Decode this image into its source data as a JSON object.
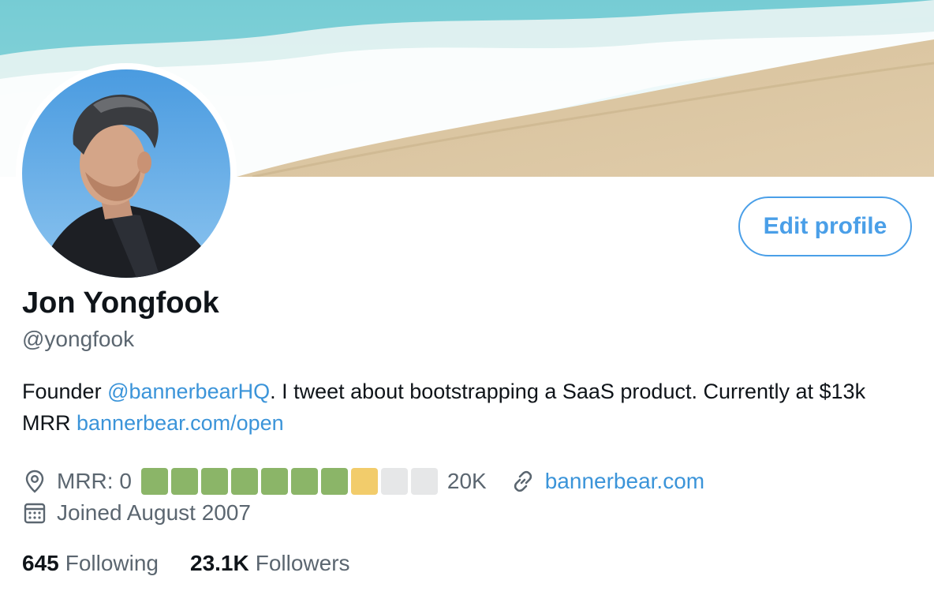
{
  "profile": {
    "name": "Jon Yongfook",
    "handle": "@yongfook",
    "edit_label": "Edit profile",
    "bio": {
      "prefix": "Founder ",
      "mention": "@bannerbearHQ",
      "middle": ". I tweet about bootstrapping a SaaS product. Currently at $13k MRR ",
      "link": "bannerbear.com/open"
    },
    "location": {
      "icon": "location-pin-icon",
      "label_start": "MRR: 0",
      "label_end": "20K",
      "progress": {
        "green_cells": 7,
        "yellow_cells": 1,
        "empty_cells": 2
      }
    },
    "website": {
      "icon": "link-icon",
      "text": "bannerbear.com"
    },
    "joined": {
      "icon": "calendar-icon",
      "text": "Joined August 2007"
    },
    "stats": {
      "following_count": "645",
      "following_label": "Following",
      "followers_count": "23.1K",
      "followers_label": "Followers"
    }
  },
  "colors": {
    "accent": "#3b94d9",
    "mrr_green": "#8bb568",
    "mrr_yellow": "#f2cc6b",
    "mrr_empty": "#e6e7e8"
  }
}
